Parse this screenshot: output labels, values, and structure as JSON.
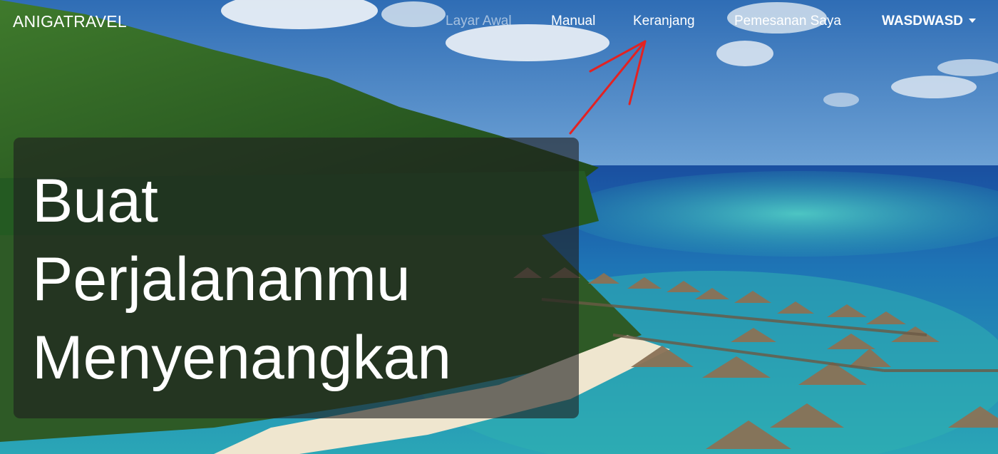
{
  "navbar": {
    "brand": "ANIGATRAVEL",
    "links": [
      {
        "label": "Layar Awal",
        "active": false
      },
      {
        "label": "Manual"
      },
      {
        "label": "Keranjang"
      },
      {
        "label": "Pemesanan Saya"
      }
    ],
    "user_menu": {
      "label": "WASDWASD",
      "icon": "caret-down-icon"
    }
  },
  "hero": {
    "title_line1": "Buat",
    "title_line2": "Perjalananmu",
    "title_line3": "Menyenangkan"
  },
  "annotation": {
    "icon": "red-arrow-icon",
    "color": "#e32222"
  },
  "colors": {
    "nav_text": "#ffffff",
    "hero_overlay": "#1e1e1e",
    "sky": "#3f7fc1",
    "lagoon": "#2fb7b8"
  }
}
